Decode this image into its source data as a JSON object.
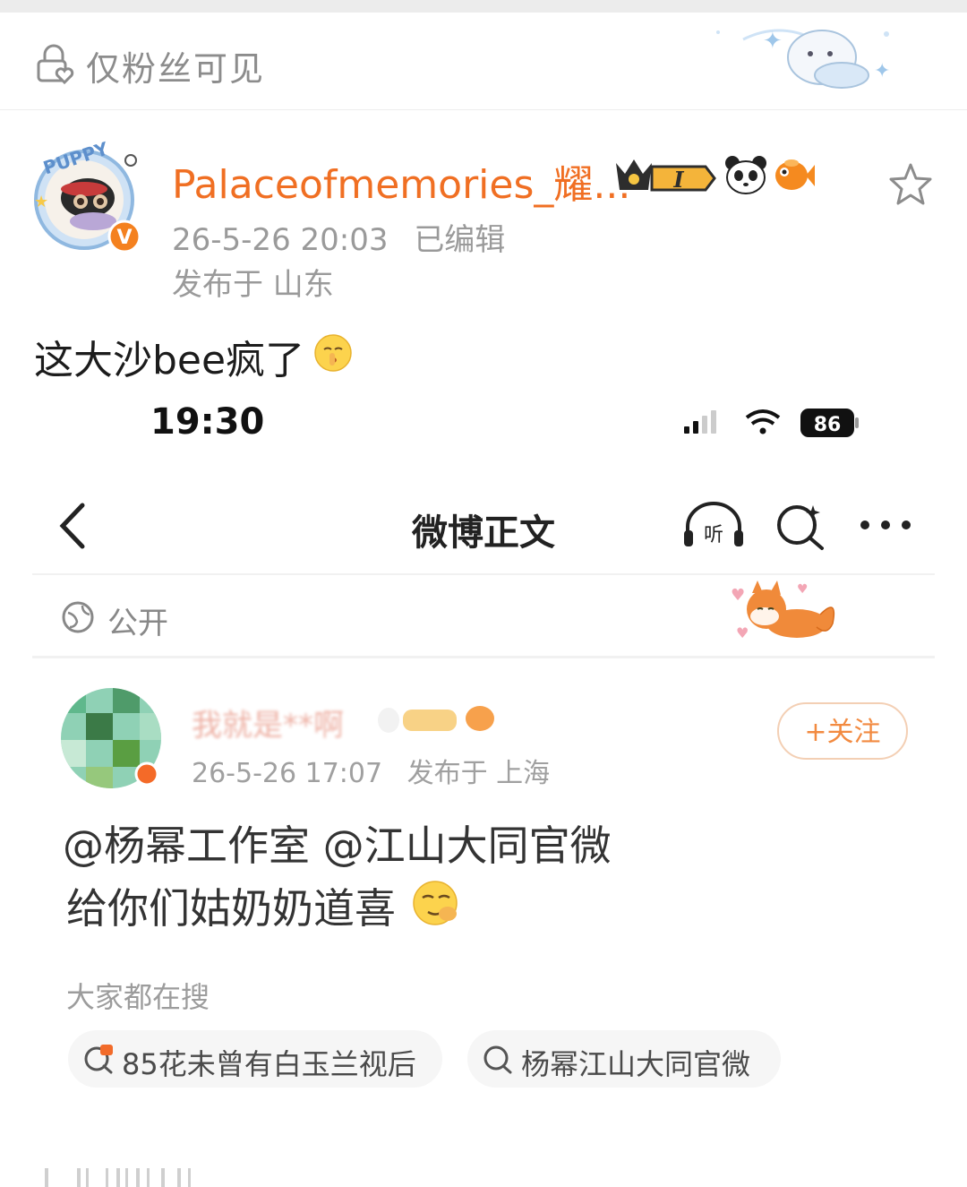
{
  "visibility": {
    "label": "仅粉丝可见",
    "icon": "lock-heart-icon"
  },
  "post": {
    "username": "Palaceofmemories_耀...",
    "timestamp": "26-5-26 20:03",
    "edited": "已编辑",
    "location": "发布于 山东",
    "text": "这大沙bee疯了",
    "badges": [
      "crown-level-badge",
      "panda-icon",
      "goldfish-icon"
    ],
    "badge_level": "I",
    "verified": "V"
  },
  "embedded": {
    "status_bar": {
      "time": "19:30",
      "battery": "86"
    },
    "nav": {
      "title": "微博正文"
    },
    "visibility": "公开",
    "author": {
      "name": "我就是**啊",
      "timestamp": "26-5-26 17:07",
      "location": "发布于 上海",
      "follow_label": "+关注"
    },
    "content": {
      "line1": "@杨幂工作室 @江山大同官微",
      "line2": "给你们姑奶奶道喜"
    },
    "trending": {
      "label": "大家都在搜",
      "items": [
        "85花未曾有白玉兰视后",
        "杨幂江山大同官微"
      ]
    }
  },
  "colors": {
    "accent_orange": "#f06f23",
    "meta_gray": "#9a9a9a",
    "follow_border": "#f3cfb4"
  }
}
